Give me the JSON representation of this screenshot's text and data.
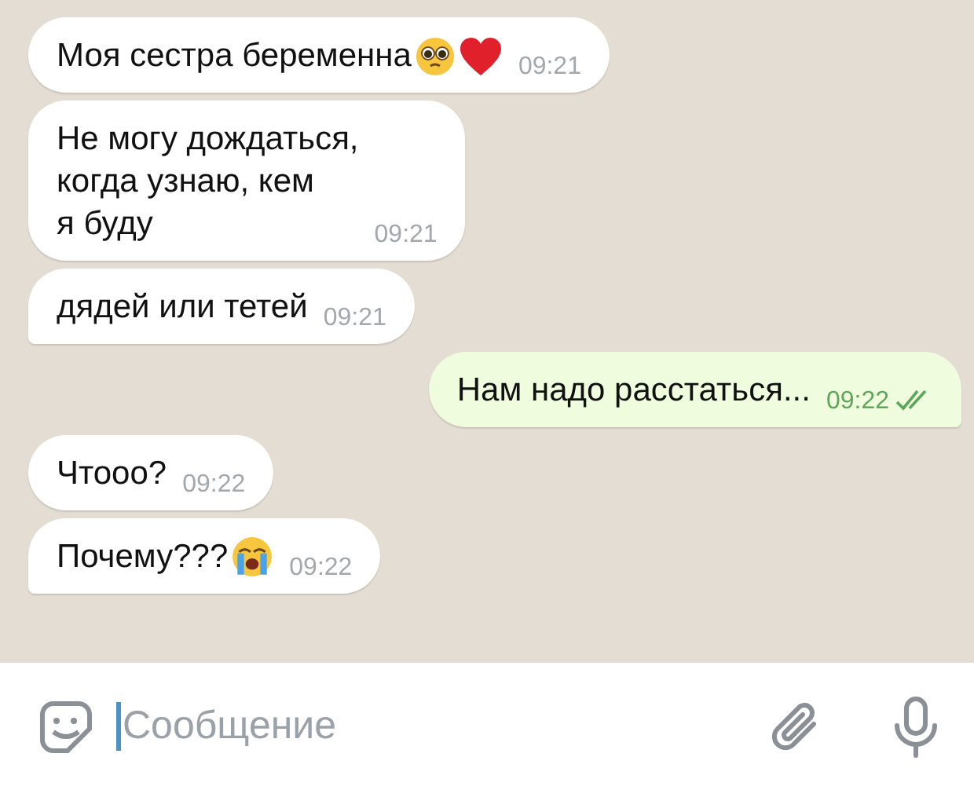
{
  "messages": [
    {
      "outgoing": false,
      "text": "Моя сестра беременна",
      "emojis": [
        {
          "kind": "pleading"
        },
        {
          "kind": "heart"
        }
      ],
      "time": "09:21"
    },
    {
      "outgoing": false,
      "text": "Не могу дождаться,\nкогда узнаю, кем\nя буду",
      "time": "09:21"
    },
    {
      "outgoing": false,
      "text": "дядей или тетей",
      "time": "09:21",
      "tail": true
    },
    {
      "outgoing": true,
      "text": "Нам надо расстаться...",
      "time": "09:22",
      "read": true,
      "tail": true
    },
    {
      "outgoing": false,
      "text": "Чтооо?",
      "time": "09:22"
    },
    {
      "outgoing": false,
      "text": "Почему???",
      "emojis": [
        {
          "kind": "crying"
        }
      ],
      "time": "09:22",
      "tail": true
    }
  ],
  "composer": {
    "placeholder": "Сообщение"
  }
}
